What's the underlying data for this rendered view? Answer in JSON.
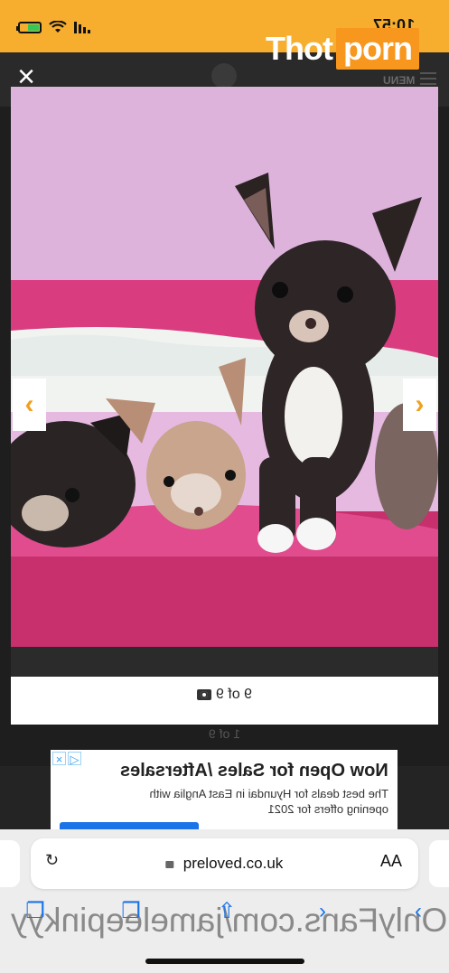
{
  "status_bar": {
    "time": "10:57"
  },
  "watermark": {
    "part1": "Thot",
    "part2": "porn"
  },
  "background_page": {
    "menu_label": "MENU",
    "counter": "1 of 9"
  },
  "lightbox": {
    "close_label": "×",
    "prev_label": "‹",
    "next_label": "›",
    "counter": "9 of 9"
  },
  "ad": {
    "title": "Now Open for Sales /Aftersales",
    "body": "The best deals for Hyundai in East Anglia with opening offers for 2021"
  },
  "browser": {
    "url": "preloved.co.uk",
    "text_size_label": "AA",
    "ghost_text": "OnlyFans.com/jameleepinkyy"
  },
  "colors": {
    "status_bar": "#f7ae2e",
    "brand_orange": "#f7971d",
    "arrow": "#f0a020"
  }
}
